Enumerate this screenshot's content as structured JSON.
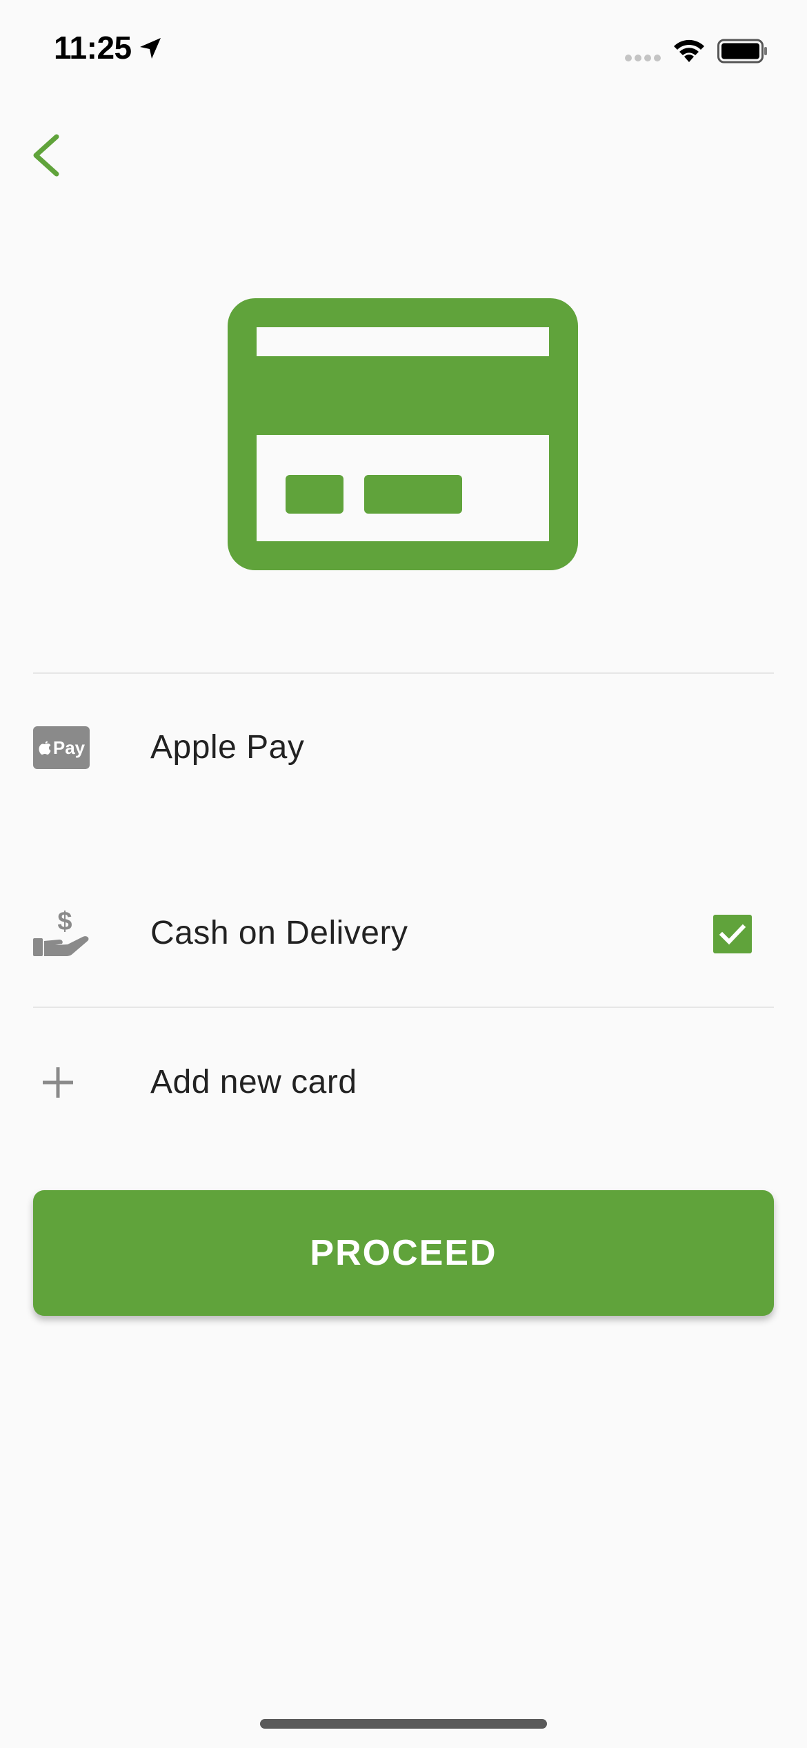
{
  "status_bar": {
    "time": "11:25"
  },
  "colors": {
    "accent": "#60a33b",
    "icon_gray": "#8a8a8a",
    "text": "#222222",
    "background": "#fafafa",
    "divider": "#e6e6e6"
  },
  "icons": {
    "back": "chevron-left-icon",
    "hero": "credit-card-icon",
    "apple_pay": "apple-pay-icon",
    "cash": "cash-hand-icon",
    "add": "plus-icon",
    "checkbox": "checkmark-icon"
  },
  "payment_options": [
    {
      "label": "Apple Pay",
      "badge_text": "Pay",
      "selected": false
    },
    {
      "label": "Cash on Delivery",
      "selected": true
    },
    {
      "label": "Add new card"
    }
  ],
  "proceed_label": "PROCEED"
}
